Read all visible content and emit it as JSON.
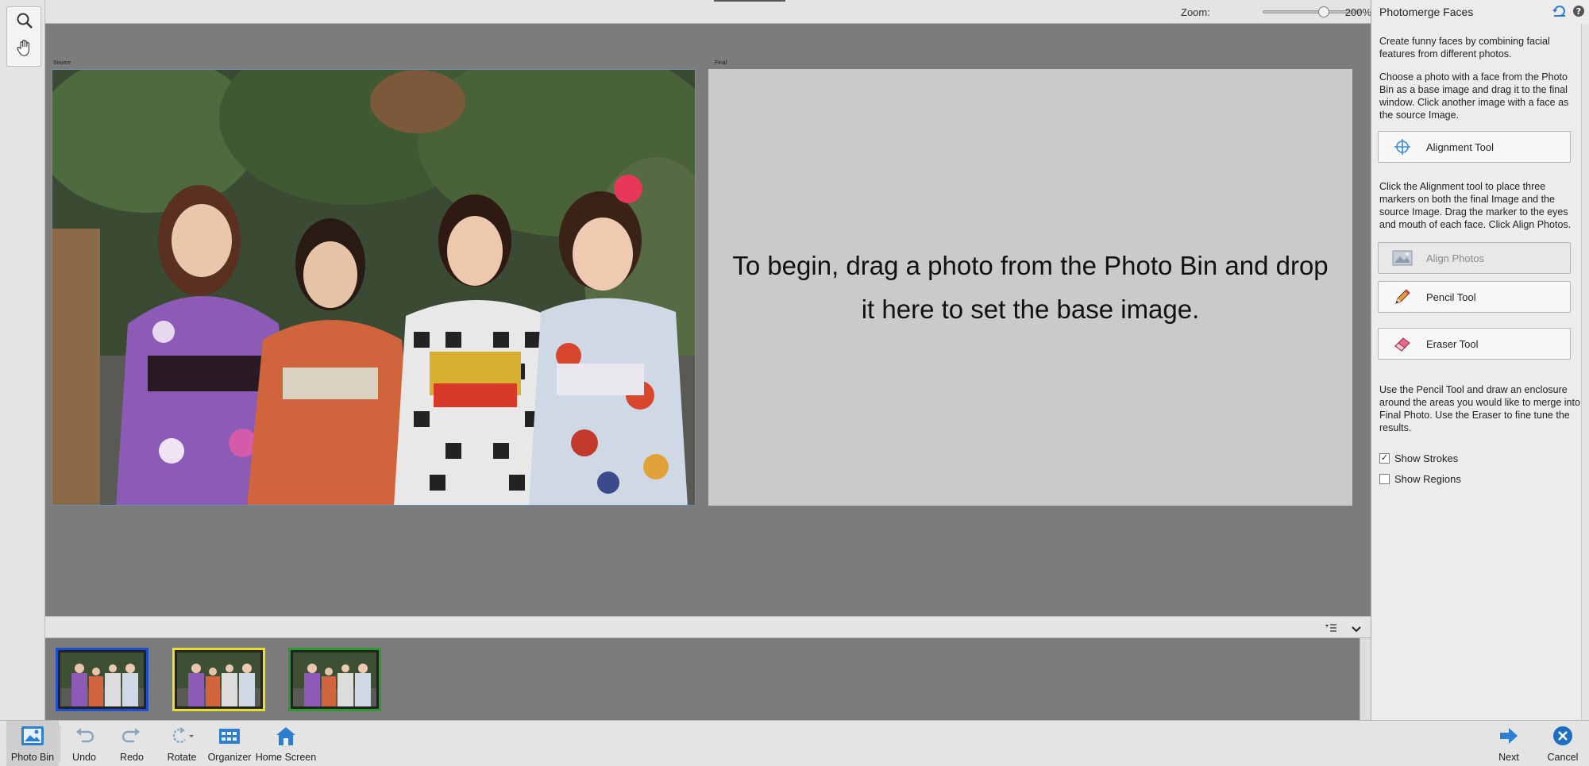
{
  "zoom": {
    "label": "Zoom:",
    "value": "200%",
    "level": 0.62
  },
  "source_pane": {
    "label": "Source"
  },
  "final_pane": {
    "label": "Final",
    "message": "To begin, drag a photo from the Photo Bin and drop it here to set the base image."
  },
  "panel": {
    "title": "Photomerge Faces",
    "intro": "Create funny faces by combining facial features from different photos.",
    "instructions": "Choose a photo with a face from the Photo Bin as a base image and drag it to the final window. Click another image with a face as the source Image.",
    "alignment_tool_label": "Alignment Tool",
    "alignment_help": "Click the Alignment tool to place three markers on both the final Image and the source Image. Drag the marker to the eyes and mouth of each face. Click Align Photos.",
    "align_photos_label": "Align Photos",
    "pencil_tool_label": "Pencil Tool",
    "eraser_tool_label": "Eraser Tool",
    "pencil_help": "Use the Pencil Tool and draw an enclosure around the areas you would like to merge into Final Photo. Use the Eraser to fine tune the results.",
    "show_strokes_label": "Show Strokes",
    "show_strokes_checked": true,
    "show_regions_label": "Show Regions",
    "show_regions_checked": false
  },
  "photo_bin": {
    "thumbs": [
      {
        "border_color": "#1f4fd1"
      },
      {
        "border_color": "#e8e020"
      },
      {
        "border_color": "#2c9a2c"
      }
    ]
  },
  "bottom_bar": {
    "photo_bin": "Photo Bin",
    "undo": "Undo",
    "redo": "Redo",
    "rotate": "Rotate",
    "organizer": "Organizer",
    "home_screen": "Home Screen",
    "next": "Next",
    "cancel": "Cancel"
  },
  "colors": {
    "accent": "#2f7fd0",
    "cancel": "#1e6fc4"
  }
}
